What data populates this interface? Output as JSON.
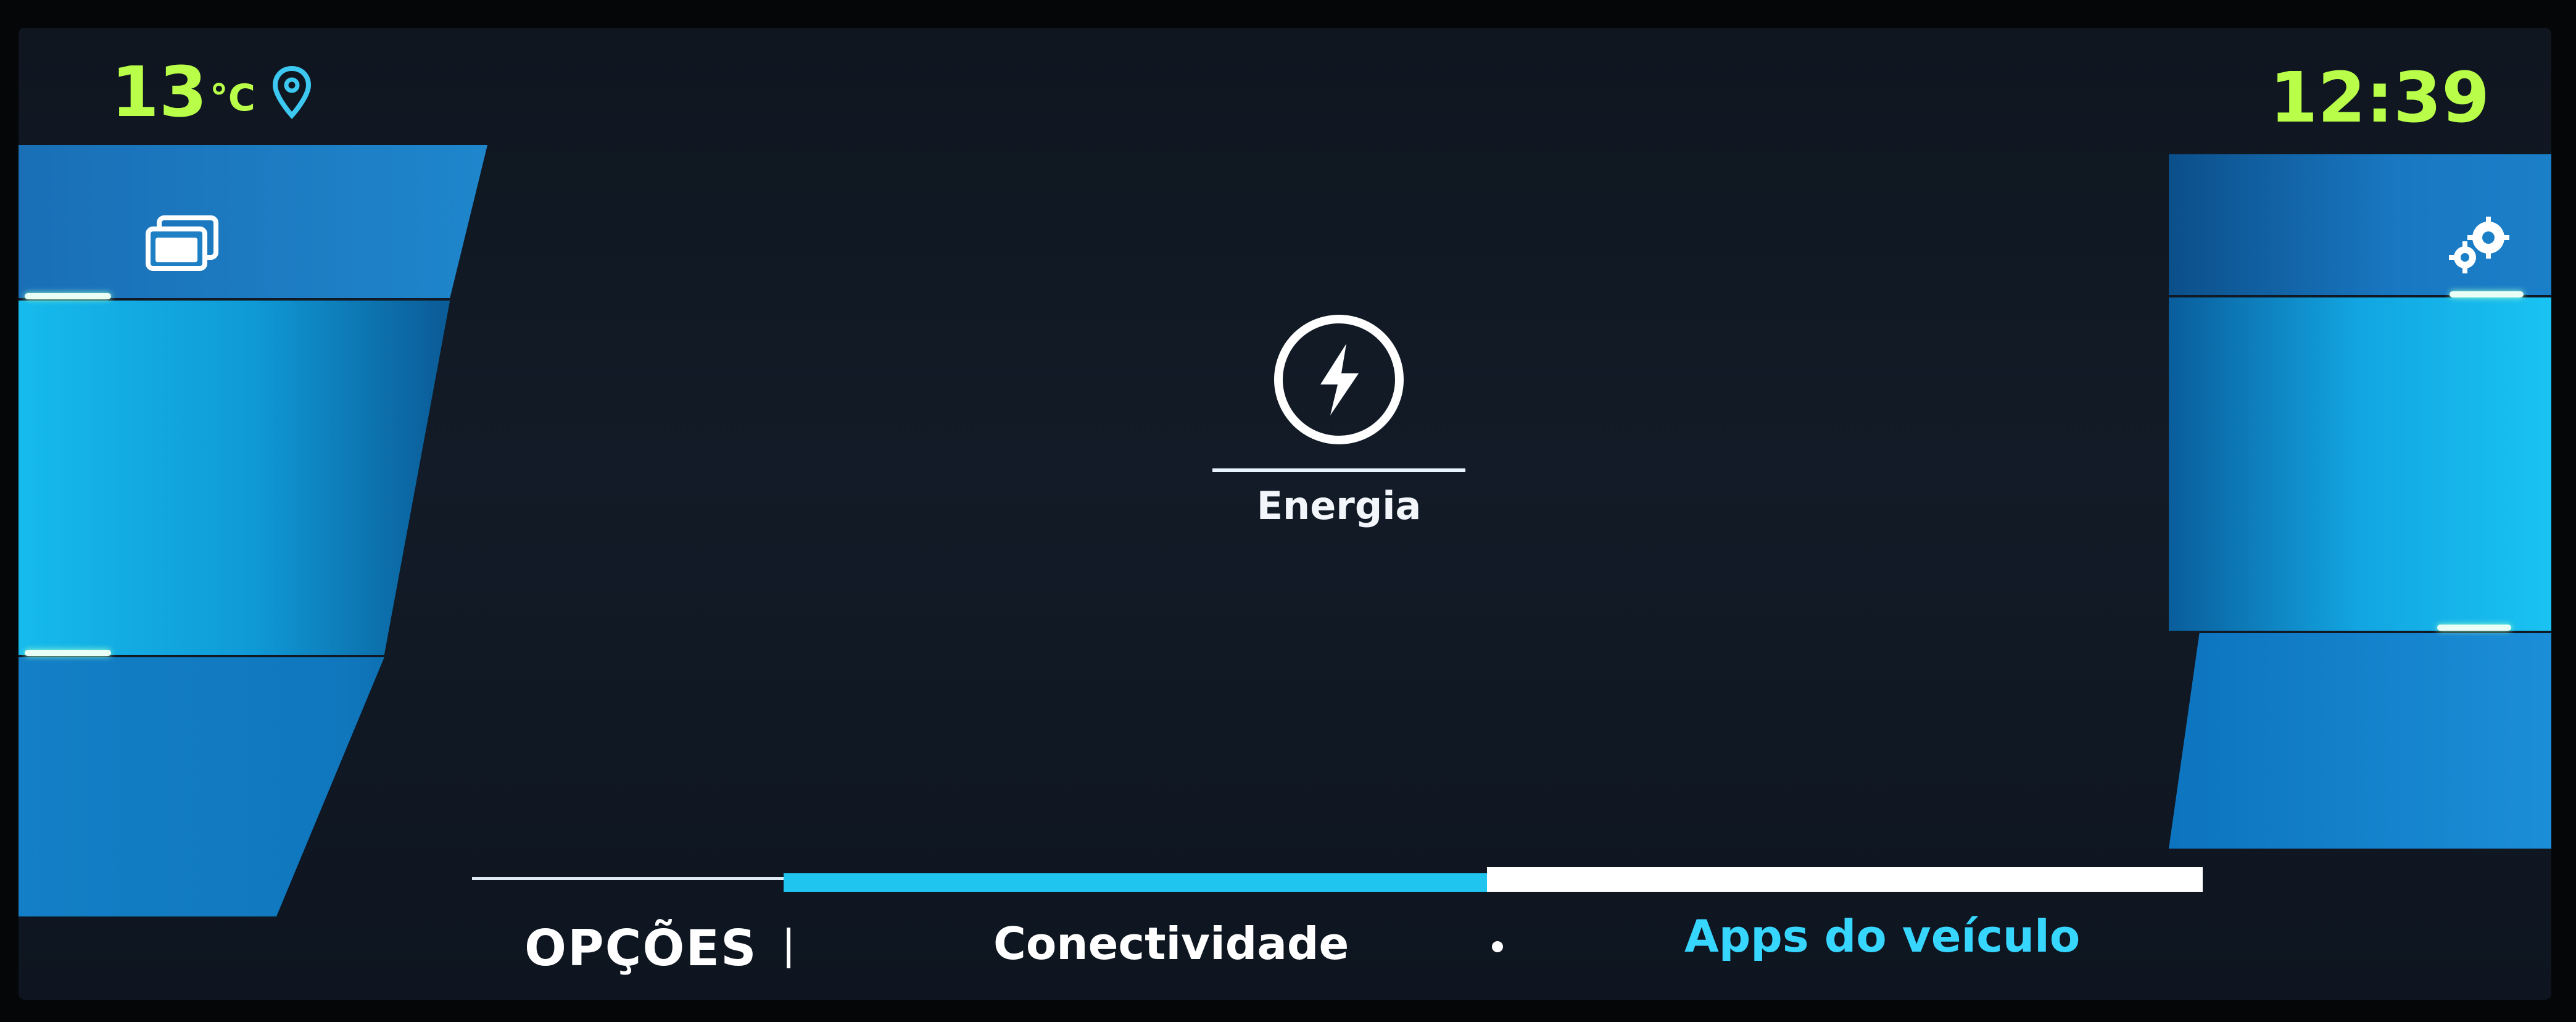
{
  "status_bar": {
    "temperature_value": "13",
    "temperature_unit": "°C",
    "location_icon": "location-pin-icon",
    "clock": "12:39"
  },
  "left_panel": {
    "icon": "stacked-windows-icon"
  },
  "right_panel": {
    "icon": "gears-icon"
  },
  "center_tile": {
    "icon": "lightning-bolt-icon",
    "label": "Energia"
  },
  "bottom_nav": {
    "options_label": "OPÇÕES",
    "tabs": [
      {
        "label": "Conectividade"
      },
      {
        "label": "Apps do veículo"
      }
    ]
  },
  "colors": {
    "status_accent": "#b9ff4a",
    "panel_blue": "#16bbec",
    "active_tab": "#36d6ff"
  }
}
